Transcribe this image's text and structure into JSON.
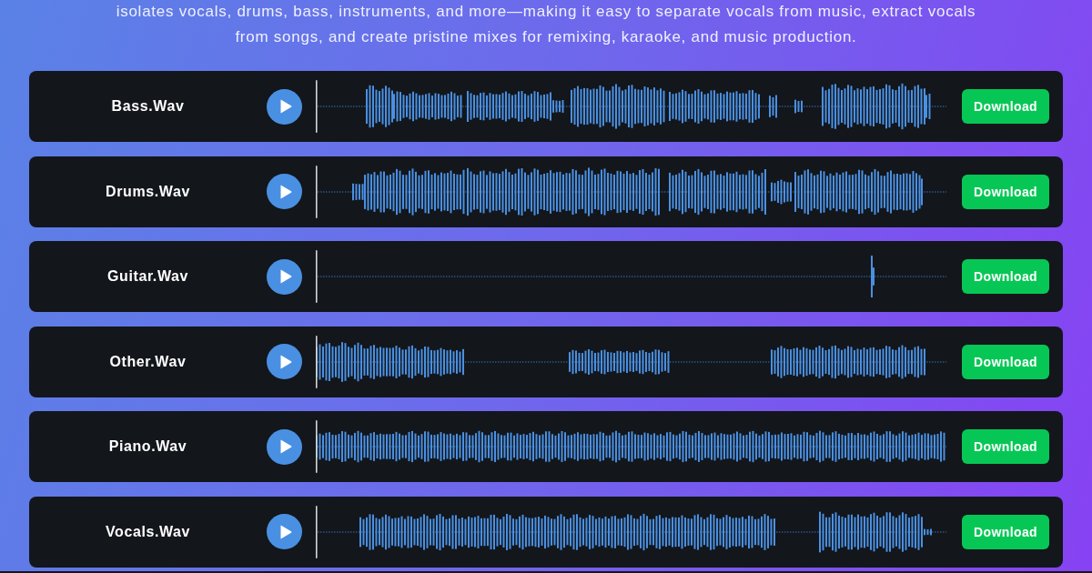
{
  "intro": {
    "text": "isolates vocals, drums, bass, instruments, and more—making it easy to separate vocals from music, extract vocals from songs, and create pristine mixes for remixing, karaoke, and music production."
  },
  "tracks": [
    {
      "name": "Bass.Wav",
      "download_label": "Download"
    },
    {
      "name": "Drums.Wav",
      "download_label": "Download"
    },
    {
      "name": "Guitar.Wav",
      "download_label": "Download"
    },
    {
      "name": "Other.Wav",
      "download_label": "Download"
    },
    {
      "name": "Piano.Wav",
      "download_label": "Download"
    },
    {
      "name": "Vocals.Wav",
      "download_label": "Download"
    }
  ]
}
